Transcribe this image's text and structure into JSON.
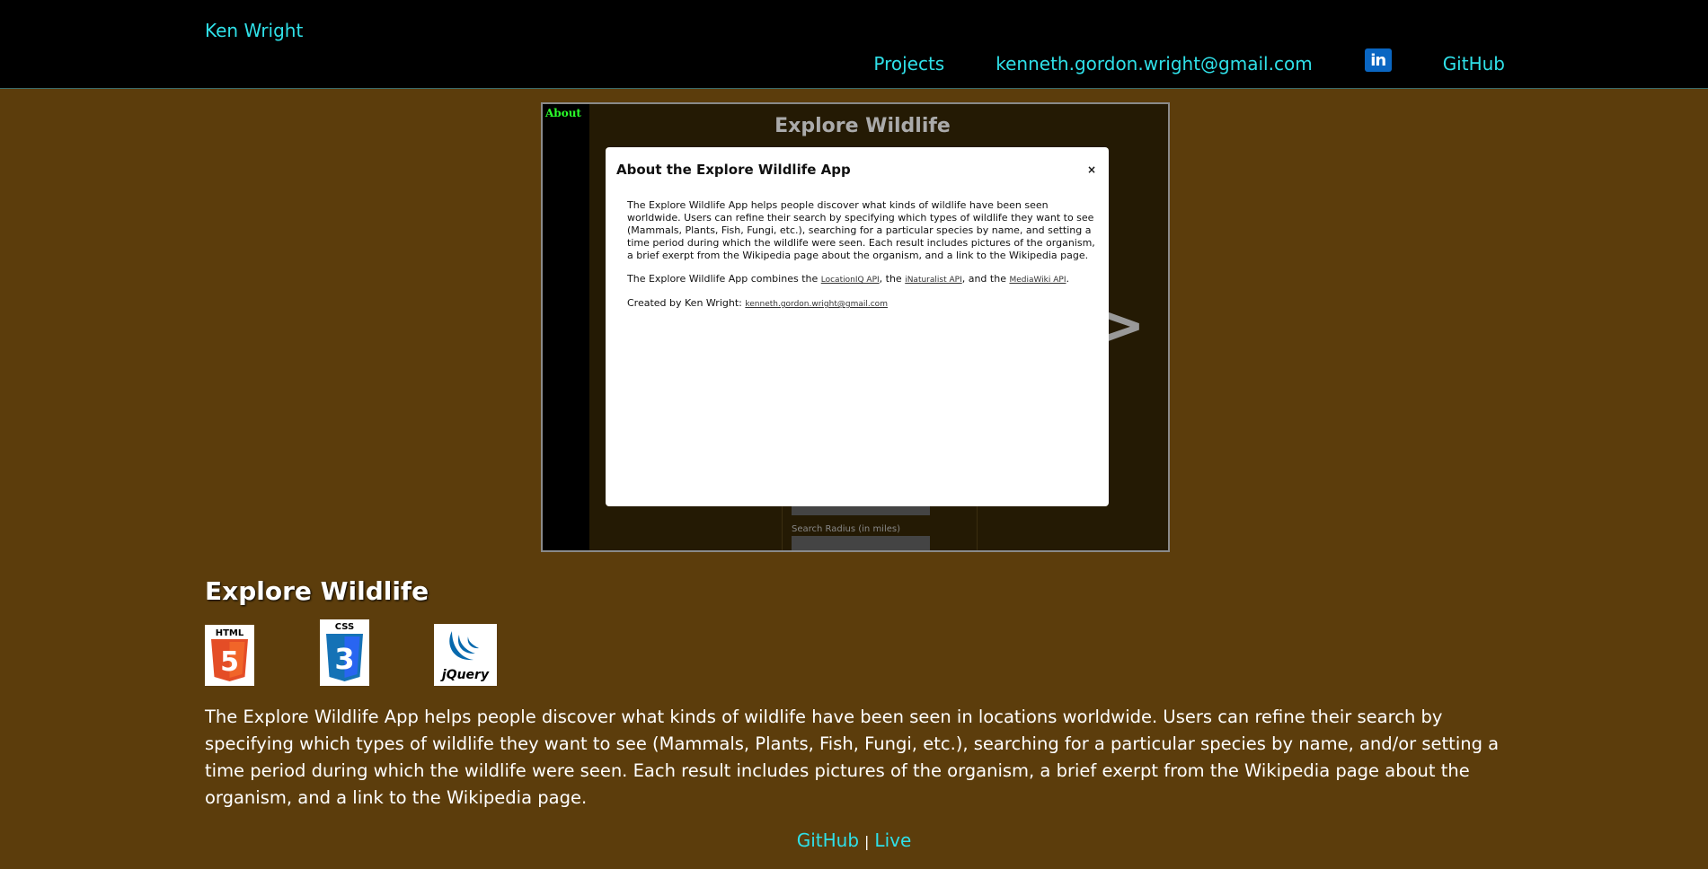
{
  "header": {
    "brand": "Ken Wright",
    "nav": {
      "projects": "Projects",
      "email": "kenneth.gordon.wright@gmail.com",
      "linkedin_icon": "in",
      "github": "GitHub"
    }
  },
  "preview": {
    "sidebar_label": "About",
    "app_title": "Explore Wildlife",
    "next_arrow": ">",
    "form_label": "Search Radius (in miles)",
    "modal": {
      "title": "About the Explore Wildlife App",
      "close": "×",
      "para1": "The Explore Wildlife App helps people discover what kinds of wildlife have been seen worldwide. Users can refine their search by specifying which types of wildlife they want to see (Mammals, Plants, Fish, Fungi, etc.), searching for a particular species by name, and setting a time period during which the wildlife were seen. Each result includes pictures of the organism, a brief exerpt from the Wikipedia page about the organism, and a link to the Wikipedia page.",
      "para2_prefix": "The Explore Wildlife App combines the ",
      "api1": "LocationIQ API",
      "para2_mid1": ", the ",
      "api2": "iNaturalist API",
      "para2_mid2": ", and the ",
      "api3": "MediaWiki API",
      "para2_suffix": ".",
      "created_prefix": "Created by Ken Wright: ",
      "created_email": "kenneth.gordon.wright@gmail.com"
    }
  },
  "project": {
    "title": "Explore Wildlife",
    "tech": {
      "html_label": "HTML",
      "html_num": "5",
      "css_label": "CSS",
      "css_num": "3",
      "jquery_label": "jQuery"
    },
    "description": "The Explore Wildlife App helps people discover what kinds of wildlife have been seen in locations worldwide. Users can refine their search by specifying which types of wildlife they want to see (Mammals, Plants, Fish, Fungi, etc.), searching for a particular species by name, and/or setting a time period during which the wildlife were seen. Each result includes pictures of the organism, a brief exerpt from the Wikipedia page about the organism, and a link to the Wikipedia page.",
    "links": {
      "github": "GitHub",
      "separator": "|",
      "live": "Live"
    }
  },
  "colors": {
    "background": "#5c3d0c",
    "header_bg": "#000000",
    "link": "#2fe0e8",
    "html_orange": "#e44d26",
    "css_blue": "#2965f1",
    "jquery_blue": "#0769ad"
  }
}
